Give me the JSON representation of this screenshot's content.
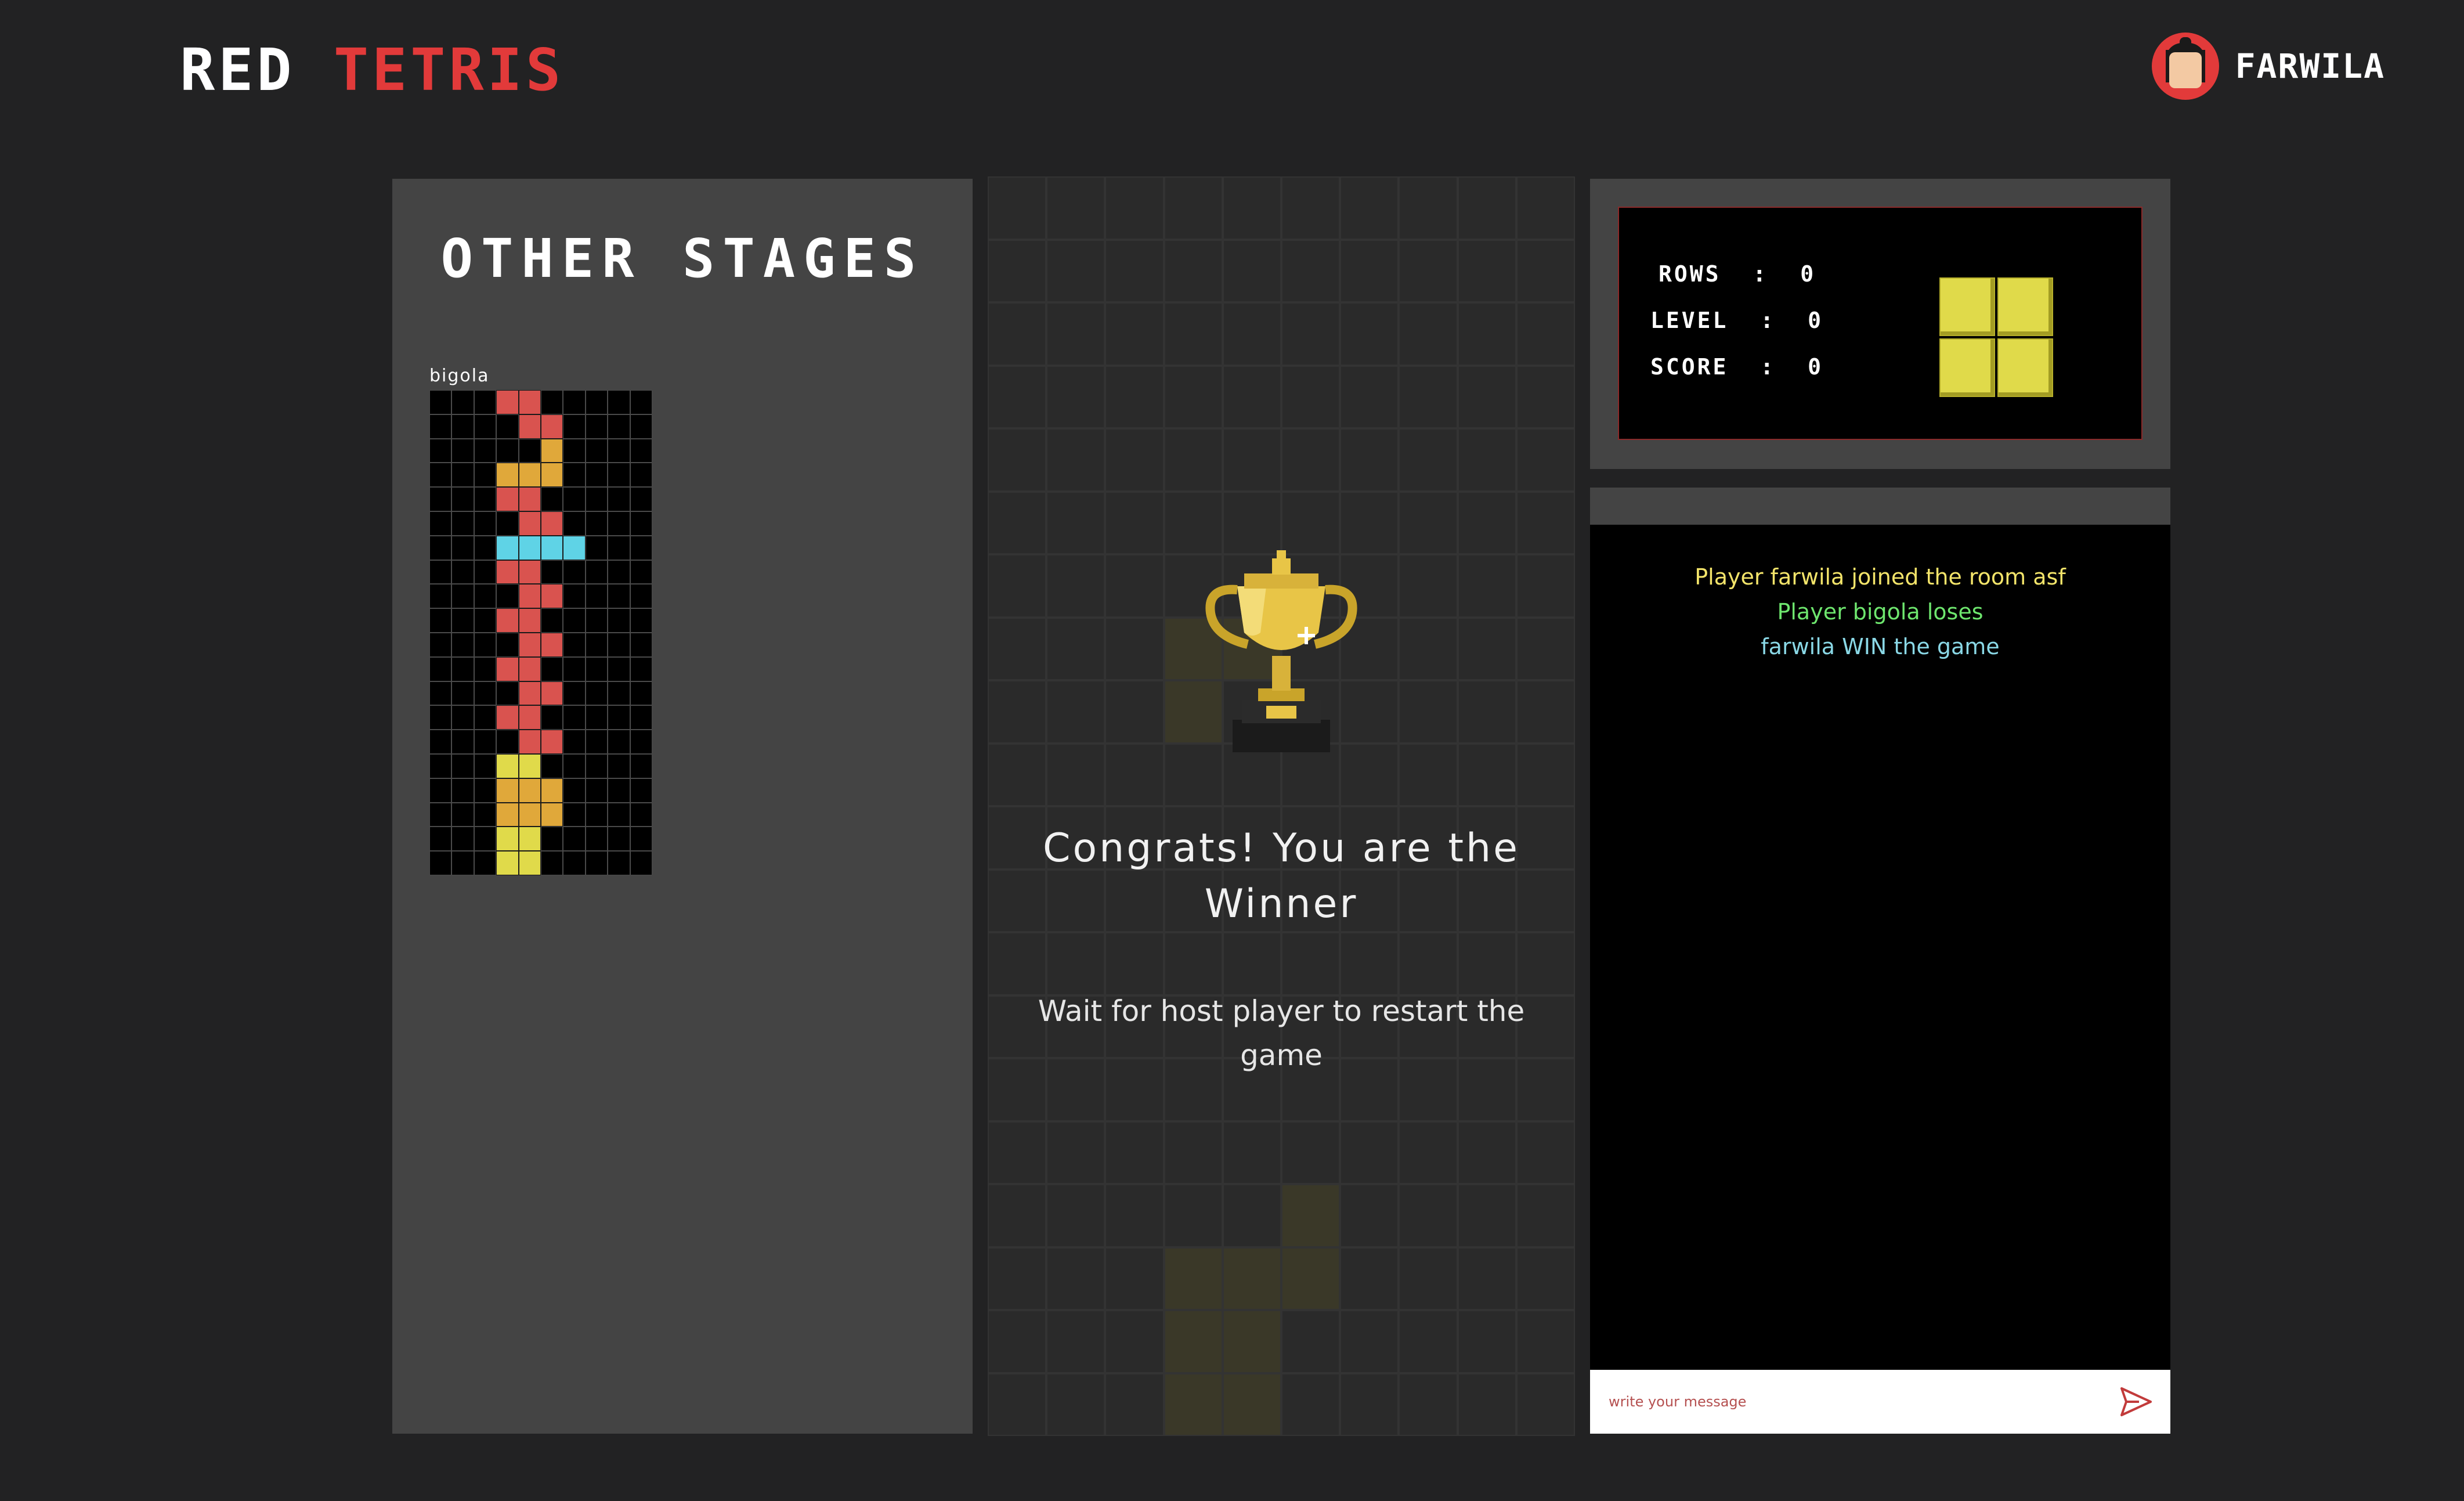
{
  "header": {
    "logo_word1": "RED",
    "logo_word2": "TETRIS",
    "username": "FARWILA"
  },
  "other_stages": {
    "title": "OTHER STAGES",
    "players": [
      {
        "name": "bigola"
      }
    ]
  },
  "game": {
    "congrats": "Congrats! You are the Winner",
    "wait_message": "Wait for host player to restart the game"
  },
  "stats": {
    "rows_label": "ROWS",
    "rows_value": "0",
    "level_label": "LEVEL",
    "level_value": "0",
    "score_label": "SCORE",
    "score_value": "0",
    "separator": ":"
  },
  "chat": {
    "messages": [
      {
        "text": "Player farwila joined the room asf",
        "color": "#f3e46a"
      },
      {
        "text": "Player bigola loses",
        "color": "#6ee66e"
      },
      {
        "text": "farwila WIN the game",
        "color": "#8ad8e6"
      }
    ],
    "placeholder": "write your message"
  },
  "colors": {
    "red": "#d9534f",
    "orange": "#e0a83a",
    "cyan": "#5fd3e6",
    "yellow": "#e0da4a",
    "accent": "#e23a3a"
  }
}
